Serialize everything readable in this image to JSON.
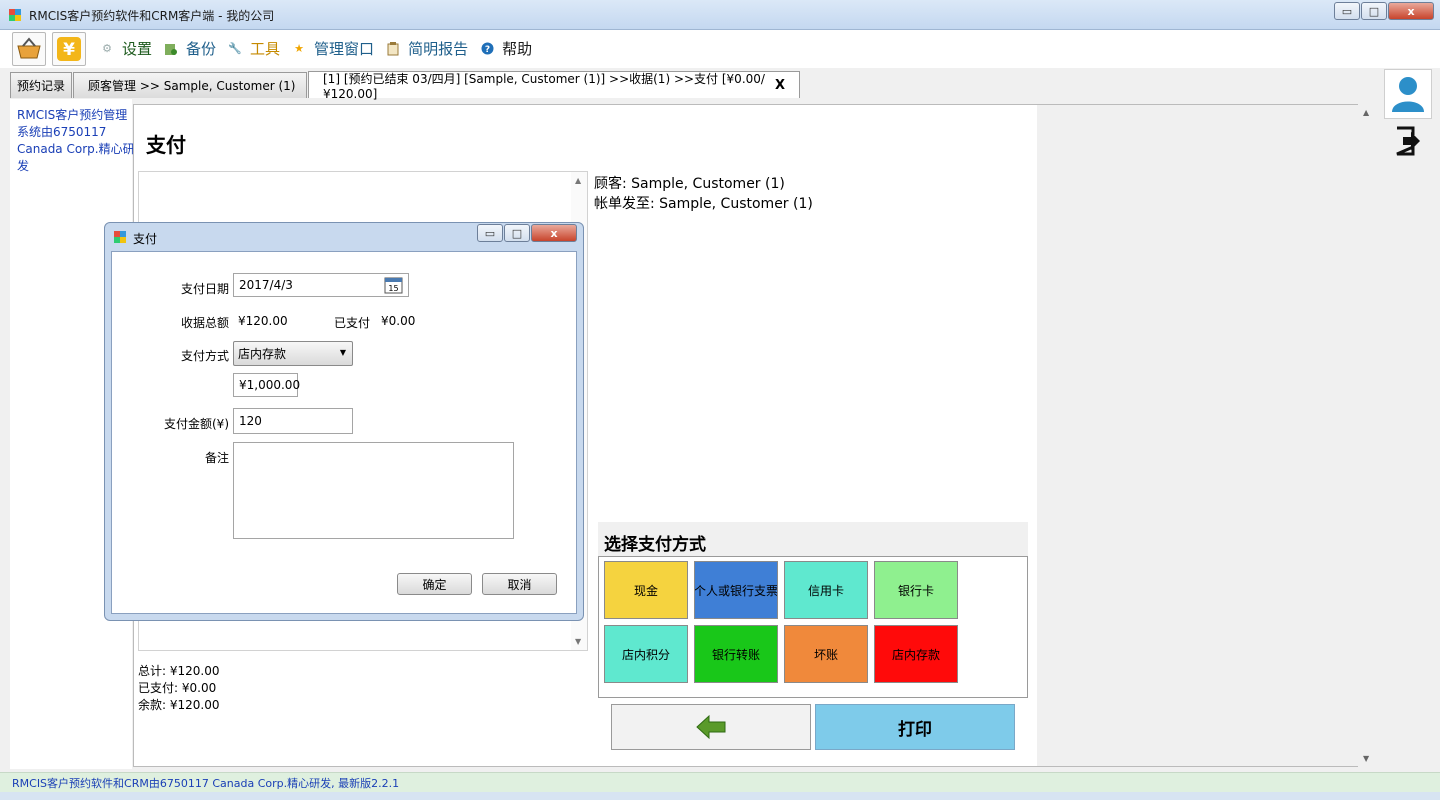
{
  "window": {
    "title": "RMCIS客户预约软件和CRM客户端 - 我的公司",
    "minimize": "▭",
    "restore": "□",
    "close": "x"
  },
  "menu": {
    "items": [
      {
        "label": "设置",
        "icon": "gear-icon",
        "color": "#1d5a1d"
      },
      {
        "label": "备份",
        "icon": "backup-icon",
        "color": "#1f5f8b"
      },
      {
        "label": "工具",
        "icon": "wrench-icon",
        "color": "#c58a00"
      },
      {
        "label": "管理窗口",
        "icon": "star-icon",
        "color": "#1f5f8b"
      },
      {
        "label": "简明报告",
        "icon": "clipboard-icon",
        "color": "#1f5f8b"
      },
      {
        "label": "帮助",
        "icon": "help-icon",
        "color": "#1b1b1b"
      }
    ]
  },
  "tabs": {
    "t1": "预约记录",
    "t2": "顾客管理 >> Sample, Customer (1)",
    "t3": "[1] [预约已结束 03/四月] [Sample, Customer (1)] >>收据(1) >>支付 [¥0.00/¥120.00]",
    "close": "X"
  },
  "leftpane": {
    "credit": "RMCIS客户预约管理系统由6750117 Canada Corp.精心研发"
  },
  "main": {
    "heading": "支付",
    "customer": "顾客: Sample, Customer (1)",
    "billto": "帐单发至: Sample, Customer (1)",
    "total": "总计: ¥120.00",
    "paid": "已支付: ¥0.00",
    "balance": "余款: ¥120.00"
  },
  "paymethods": {
    "title": "选择支付方式",
    "buttons": [
      {
        "label": "现金",
        "color": "#f5d33f"
      },
      {
        "label": "个人或银行支票",
        "color": "#3f7fd6"
      },
      {
        "label": "信用卡",
        "color": "#5fe8cf"
      },
      {
        "label": "银行卡",
        "color": "#8ff08f"
      },
      {
        "label": "店内积分",
        "color": "#5fe8cf"
      },
      {
        "label": "银行转账",
        "color": "#19c719"
      },
      {
        "label": "坏账",
        "color": "#f0893b"
      },
      {
        "label": "店内存款",
        "color": "#ff0a0a"
      }
    ],
    "print": "打印"
  },
  "dialog": {
    "title": "支付",
    "date_label": "支付日期",
    "date_value": "2017/4/3",
    "calendar_day": "15",
    "total_label": "收据总额",
    "total_value": "¥120.00",
    "paid_label": "已支付",
    "paid_value": "¥0.00",
    "method_label": "支付方式",
    "method_value": "店内存款",
    "balance_value": "¥1,000.00",
    "amount_label": "支付金额(¥)",
    "amount_value": "120",
    "note_label": "备注",
    "ok": "确定",
    "cancel": "取消"
  },
  "status": "RMCIS客户预约软件和CRM由6750117 Canada Corp.精心研发, 最新版2.2.1"
}
